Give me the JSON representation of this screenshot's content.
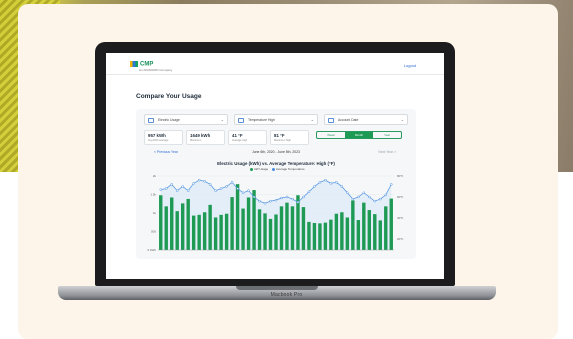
{
  "colors": {
    "brand_green": "#1f9a55",
    "temp_line": "#4a8fe0",
    "temp_fill": "#dbe9f8",
    "card_bg": "#fdf5e9",
    "link_blue": "#2e6bd6"
  },
  "device": {
    "base_label": "Macbook Pro"
  },
  "app": {
    "logo_text": "CMP",
    "logo_subtitle": "An AVANGRID Company",
    "logout_label": "Logout",
    "page_title": "Compare Your Usage",
    "selects": [
      {
        "label": "Electric Usage",
        "icon": "chart-icon"
      },
      {
        "label": "Temperature High",
        "icon": "thermometer-icon"
      },
      {
        "label": "Account Date",
        "icon": "calendar-icon"
      }
    ],
    "stats": [
      {
        "value": "957 kWh",
        "label": "Avg kWh average"
      },
      {
        "value": "1649 kWh",
        "label": "Maximum"
      },
      {
        "value": "41 °F",
        "label": "Average high"
      },
      {
        "value": "81 °F",
        "label": "Maximum high"
      }
    ],
    "segments": {
      "options": [
        "Week",
        "Month",
        "Year"
      ],
      "selected": "Month"
    },
    "nav": {
      "prev_label": "< Previous Year",
      "range": "June 6th, 2020 - June 5th, 2023",
      "next_label": "Next Year >"
    }
  },
  "chart_data": {
    "type": "bar",
    "title": "Electric Usage (kWh) vs. Average Temperature: High (°F)",
    "legend": [
      "kW Usage",
      "Average Temperature"
    ],
    "legend_placement": "top",
    "y_left_ticks": [
      "2k",
      "1.5k",
      "1k",
      "500",
      "0 kWh"
    ],
    "y_right_ticks": [
      "80°F",
      "60°F",
      "40°F",
      "20°F"
    ],
    "usage_kwh": [
      1480,
      1180,
      1420,
      1050,
      1260,
      1380,
      930,
      950,
      1020,
      1220,
      880,
      950,
      980,
      1430,
      1780,
      1120,
      1420,
      1620,
      1100,
      990,
      840,
      960,
      1180,
      1280,
      1180,
      1480,
      1160,
      760,
      730,
      720,
      740,
      820,
      980,
      1020,
      880,
      1340,
      810,
      1280,
      1080,
      970,
      800,
      1180,
      1390
    ],
    "avg_temp_f": [
      67,
      68,
      72,
      66,
      70,
      66,
      73,
      76,
      75,
      72,
      66,
      68,
      70,
      74,
      68,
      64,
      66,
      60,
      56,
      54,
      56,
      57,
      59,
      60,
      58,
      55,
      60,
      65,
      70,
      74,
      76,
      73,
      74,
      70,
      64,
      58,
      60,
      64,
      60,
      56,
      58,
      62,
      72
    ],
    "grid": true
  }
}
